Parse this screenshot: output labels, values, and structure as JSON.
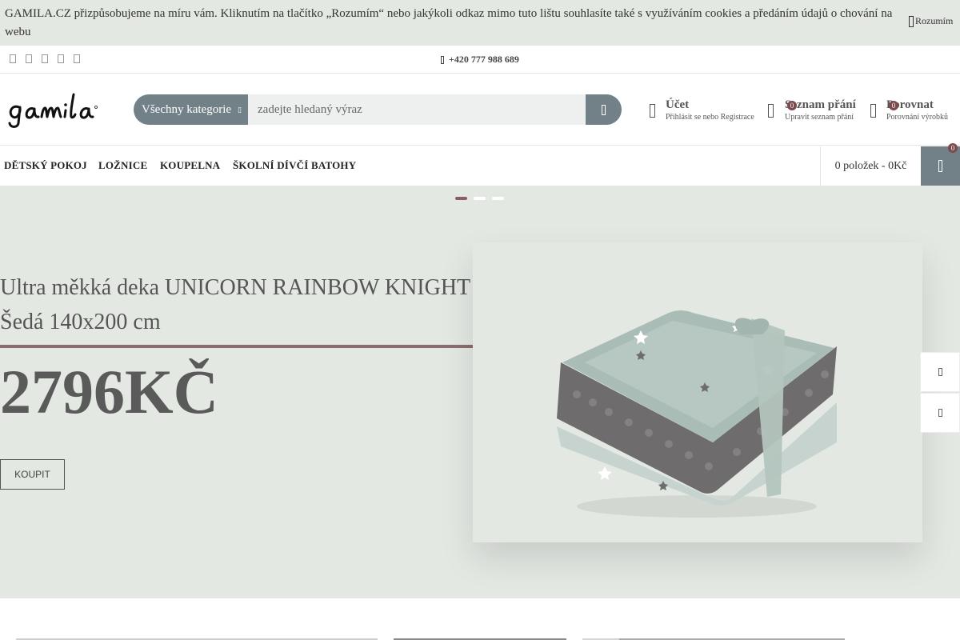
{
  "cookie_bar": {
    "text": "GAMILA.CZ přizpůsobujeme na míru vám. Kliknutím na tlačítko „Rozumím“ nebo jakýkoli odkaz mimo tuto lištu souhlasíte také s využíváním cookies a předáním údajů o chování na webu",
    "accept_label": "Rozumím"
  },
  "top_bar": {
    "phone": "+420 777 988 689",
    "social_icons": [
      "facebook-icon",
      "instagram-icon",
      "twitter-icon",
      "pinterest-icon",
      "youtube-icon"
    ]
  },
  "header": {
    "search": {
      "category_label": "Všechny kategorie",
      "placeholder": "zadejte hledaný výraz"
    },
    "account": {
      "title": "Účet",
      "subtitle": "Přihlásit se nebo Registrace"
    },
    "wishlist": {
      "title": "Seznam přání",
      "subtitle": "Upravit seznam přání",
      "count": "0"
    },
    "compare": {
      "title": "Porovnat",
      "subtitle": "Porovnání výrobků",
      "count": "0"
    }
  },
  "nav": {
    "items": [
      "DĚTSKÝ POKOJ",
      "LOŽNICE",
      "KOUPELNA",
      "ŠKOLNÍ DÍVČÍ BATOHY"
    ],
    "cart_summary": "0 položek - 0Kč",
    "cart_count": "0"
  },
  "hero": {
    "title": "Ultra měkká deka UNICORN RAINBOW KNIGHT Šedá 140x200 cm",
    "price": "2796KČ",
    "buy_label": "KOUPIT",
    "slides_total": 3,
    "active_slide": 1
  },
  "colors": {
    "accent": "#728087",
    "hero_bg": "#e4e8e3",
    "brand_rose": "#8e6b6e",
    "badge": "#7a4a4d"
  }
}
